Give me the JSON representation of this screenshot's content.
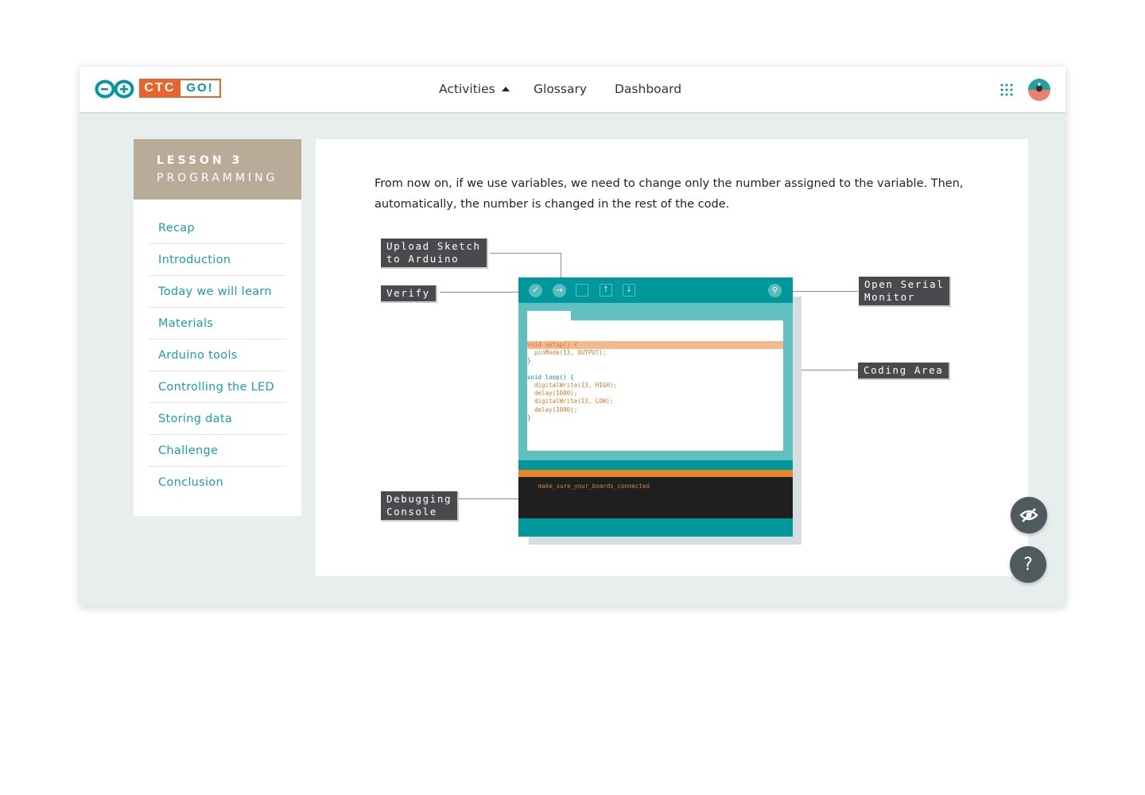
{
  "header": {
    "brand": {
      "ctc": "CTC",
      "go": "GO!"
    },
    "nav": [
      {
        "label": "Activities"
      },
      {
        "label": "Glossary"
      },
      {
        "label": "Dashboard"
      }
    ]
  },
  "sidebar": {
    "lesson_number": "LESSON 3",
    "lesson_title": "PROGRAMMING",
    "items": [
      {
        "label": "Recap"
      },
      {
        "label": "Introduction"
      },
      {
        "label": "Today we will learn"
      },
      {
        "label": "Materials"
      },
      {
        "label": "Arduino tools"
      },
      {
        "label": "Controlling the LED"
      },
      {
        "label": "Storing data"
      },
      {
        "label": "Challenge"
      },
      {
        "label": "Conclusion"
      }
    ]
  },
  "main": {
    "paragraph": "From now on, if we use variables, we need to change only the number assigned to the variable. Then, automatically, the number is changed in the rest of the code.",
    "diagram": {
      "labels": {
        "upload": "Upload Sketch\nto Arduino",
        "verify": "Verify",
        "serial": "Open Serial\nMonitor",
        "coding": "Coding Area",
        "debug": "Debugging\nConsole"
      },
      "code": {
        "line1": "void setup() {",
        "line2": "  pinMode(13, OUTPUT);",
        "line3": "}",
        "line4": "void loop() {",
        "line5": "  digitalWrite(13, HIGH);",
        "line6": "  delay(1000);",
        "line7": "  digitalWrite(13, LOW);",
        "line8": "  delay(1000);",
        "line9": "}"
      },
      "console_text": "make_sure_your_boards_connected"
    }
  },
  "fabs": {
    "help": "?"
  },
  "colors": {
    "teal": "#00979d",
    "orange": "#e8642c",
    "lesson_bg": "#b8ab98",
    "link": "#1aa0a6"
  }
}
